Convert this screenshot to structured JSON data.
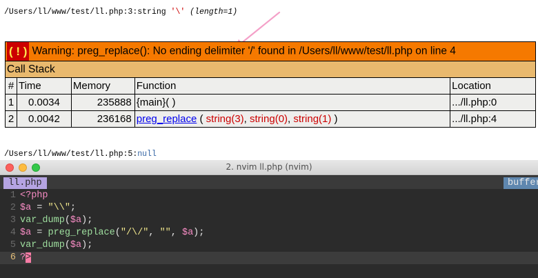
{
  "browser": {
    "var_dump_1": {
      "path": "/Users/ll/www/test/ll.php:3:",
      "type": "string ",
      "value": "'\\'",
      "length": "(length=1)"
    },
    "warning": {
      "badge": "( ! )",
      "message": "Warning: preg_replace(): No ending delimiter '/' found in /Users/ll/www/test/ll.php on line 4"
    },
    "call_stack": {
      "title": "Call Stack",
      "columns": [
        "#",
        "Time",
        "Memory",
        "Function",
        "Location"
      ],
      "rows": [
        {
          "num": "1",
          "time": "0.0034",
          "memory": "235888",
          "function": "{main}( )",
          "location": ".../ll.php:0"
        },
        {
          "num": "2",
          "time": "0.0042",
          "memory": "236168",
          "function_name": "preg_replace",
          "args_open": " ( ",
          "arg1": "string(3)",
          "sep1": ", ",
          "arg2": "string(0)",
          "sep2": ", ",
          "arg3": "string(1)",
          "args_close": " )",
          "location": ".../ll.php:4"
        }
      ]
    },
    "var_dump_2": {
      "path": "/Users/ll/www/test/ll.php:5:",
      "value": "null"
    }
  },
  "terminal": {
    "title": "2. nvim ll.php (nvim)",
    "tab_file": "ll.php",
    "tab_buffers": "buffers",
    "lines": [
      {
        "num": "1",
        "tokens": [
          {
            "t": "kw",
            "v": "<?php"
          }
        ]
      },
      {
        "num": "2",
        "tokens": [
          {
            "t": "vr",
            "v": "$a"
          },
          {
            "t": "pn",
            "v": " = "
          },
          {
            "t": "st",
            "v": "\"\\\\\""
          },
          {
            "t": "pn",
            "v": ";"
          }
        ]
      },
      {
        "num": "3",
        "tokens": [
          {
            "t": "fn",
            "v": "var_dump"
          },
          {
            "t": "pn",
            "v": "("
          },
          {
            "t": "vr",
            "v": "$a"
          },
          {
            "t": "pn",
            "v": ");"
          }
        ]
      },
      {
        "num": "4",
        "tokens": [
          {
            "t": "vr",
            "v": "$a"
          },
          {
            "t": "pn",
            "v": " = "
          },
          {
            "t": "fn",
            "v": "preg_replace"
          },
          {
            "t": "pn",
            "v": "("
          },
          {
            "t": "st",
            "v": "\"/\\/\""
          },
          {
            "t": "pn",
            "v": ", "
          },
          {
            "t": "st",
            "v": "\"\""
          },
          {
            "t": "pn",
            "v": ", "
          },
          {
            "t": "vr",
            "v": "$a"
          },
          {
            "t": "pn",
            "v": ");"
          }
        ]
      },
      {
        "num": "5",
        "tokens": [
          {
            "t": "fn",
            "v": "var_dump"
          },
          {
            "t": "pn",
            "v": "("
          },
          {
            "t": "vr",
            "v": "$a"
          },
          {
            "t": "pn",
            "v": ");"
          }
        ]
      },
      {
        "num": "6",
        "current": true,
        "tokens": [
          {
            "t": "kw",
            "v": "?"
          },
          {
            "t": "cursor",
            "v": ">"
          }
        ]
      }
    ]
  },
  "colors": {
    "warning_bg": "#f57900",
    "badge_bg": "#cc0000",
    "badge_fg": "#fce94f",
    "callstack_header_bg": "#e9b96e",
    "row_bg": "#eeeeec",
    "arrow": "#f4a0c8",
    "terminal_bg": "#2b2b2b",
    "tab_active": "#b5a4e2",
    "tab_buffers": "#5f87af"
  }
}
